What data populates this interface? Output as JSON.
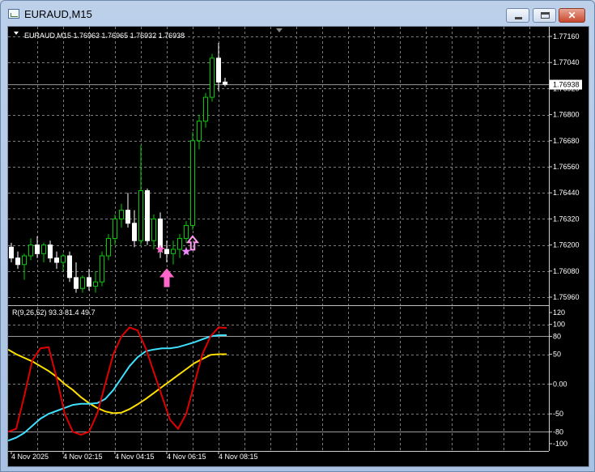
{
  "window": {
    "title": "EURAUD,M15",
    "min_glyph": "",
    "max_glyph": "",
    "close_glyph": "✕"
  },
  "main_chart": {
    "info_text": "EURAUD,M15  1.76963 1.76965 1.76932 1.76938",
    "price_labels": [
      "1.77160",
      "1.77040",
      "1.76920",
      "1.76800",
      "1.76680",
      "1.76560",
      "1.76440",
      "1.76320",
      "1.76200",
      "1.76080",
      "1.75960"
    ],
    "current_price_label": "1.76938"
  },
  "indicator": {
    "info_text": "R(9,26,52) 93.3 81.4 49.7",
    "scale_labels": [
      "120",
      "100",
      "80",
      "50",
      "0.00",
      "-50",
      "-80",
      "-100"
    ]
  },
  "time_labels": [
    "4 Nov 2025",
    "4 Nov 02:15",
    "4 Nov 04:15",
    "4 Nov 06:15",
    "4 Nov 08:15"
  ],
  "colors": {
    "bull": "#00cc00",
    "bear": "#ffffff",
    "grid": "#7a7a7a",
    "red_line": "#e00000",
    "cyan_line": "#40e0ff",
    "yellow_line": "#ffe000",
    "arrow": "#ff66cc",
    "arrow_light": "#ff99ee",
    "star": "#ff66cc",
    "star_light": "#ee88ff"
  },
  "chart_data": {
    "type": "candlestick",
    "price_axis": {
      "min": 1.7596,
      "max": 1.7716
    },
    "current_price": 1.76938,
    "candles": [
      {
        "o": 1.7619,
        "h": 1.7621,
        "l": 1.7612,
        "c": 1.7614
      },
      {
        "o": 1.7614,
        "h": 1.7617,
        "l": 1.7609,
        "c": 1.7611
      },
      {
        "o": 1.7611,
        "h": 1.7616,
        "l": 1.7604,
        "c": 1.7615
      },
      {
        "o": 1.7615,
        "h": 1.7623,
        "l": 1.7613,
        "c": 1.762
      },
      {
        "o": 1.762,
        "h": 1.7624,
        "l": 1.7614,
        "c": 1.7616
      },
      {
        "o": 1.7616,
        "h": 1.7621,
        "l": 1.7612,
        "c": 1.762
      },
      {
        "o": 1.762,
        "h": 1.7622,
        "l": 1.7612,
        "c": 1.7614
      },
      {
        "o": 1.7614,
        "h": 1.7617,
        "l": 1.7609,
        "c": 1.7612
      },
      {
        "o": 1.7612,
        "h": 1.7616,
        "l": 1.7608,
        "c": 1.7615
      },
      {
        "o": 1.7615,
        "h": 1.7617,
        "l": 1.7603,
        "c": 1.7605
      },
      {
        "o": 1.7605,
        "h": 1.7612,
        "l": 1.7598,
        "c": 1.76
      },
      {
        "o": 1.76,
        "h": 1.7606,
        "l": 1.7598,
        "c": 1.7605
      },
      {
        "o": 1.7605,
        "h": 1.7609,
        "l": 1.7599,
        "c": 1.7601
      },
      {
        "o": 1.7601,
        "h": 1.7608,
        "l": 1.7598,
        "c": 1.7603
      },
      {
        "o": 1.7603,
        "h": 1.7617,
        "l": 1.7601,
        "c": 1.7615
      },
      {
        "o": 1.7615,
        "h": 1.7625,
        "l": 1.7613,
        "c": 1.7623
      },
      {
        "o": 1.7623,
        "h": 1.7634,
        "l": 1.762,
        "c": 1.7632
      },
      {
        "o": 1.7632,
        "h": 1.7639,
        "l": 1.7628,
        "c": 1.7636
      },
      {
        "o": 1.7636,
        "h": 1.7644,
        "l": 1.7628,
        "c": 1.763
      },
      {
        "o": 1.763,
        "h": 1.7636,
        "l": 1.7619,
        "c": 1.7622
      },
      {
        "o": 1.7622,
        "h": 1.7666,
        "l": 1.762,
        "c": 1.7645
      },
      {
        "o": 1.7645,
        "h": 1.7646,
        "l": 1.762,
        "c": 1.7622
      },
      {
        "o": 1.7622,
        "h": 1.7634,
        "l": 1.7618,
        "c": 1.7632
      },
      {
        "o": 1.7632,
        "h": 1.7635,
        "l": 1.7614,
        "c": 1.7618
      },
      {
        "o": 1.7618,
        "h": 1.7622,
        "l": 1.7612,
        "c": 1.7616
      },
      {
        "o": 1.7616,
        "h": 1.7622,
        "l": 1.7611,
        "c": 1.7618
      },
      {
        "o": 1.7618,
        "h": 1.7625,
        "l": 1.7614,
        "c": 1.7623
      },
      {
        "o": 1.7623,
        "h": 1.7631,
        "l": 1.7621,
        "c": 1.7629
      },
      {
        "o": 1.7629,
        "h": 1.7672,
        "l": 1.7627,
        "c": 1.7668
      },
      {
        "o": 1.7668,
        "h": 1.768,
        "l": 1.7664,
        "c": 1.7677
      },
      {
        "o": 1.7677,
        "h": 1.769,
        "l": 1.7674,
        "c": 1.7688
      },
      {
        "o": 1.7688,
        "h": 1.7708,
        "l": 1.7686,
        "c": 1.7706
      },
      {
        "o": 1.7706,
        "h": 1.7713,
        "l": 1.7691,
        "c": 1.7695
      },
      {
        "o": 1.7695,
        "h": 1.7697,
        "l": 1.7693,
        "c": 1.7694
      }
    ],
    "signals": [
      {
        "type": "arrow",
        "index": 24,
        "price": 1.7609,
        "size": "large",
        "color": "arrow"
      },
      {
        "type": "arrow",
        "index": 28,
        "price": 1.7624,
        "size": "small",
        "color": "arrow_light"
      },
      {
        "type": "star",
        "index": 23,
        "price": 1.7618,
        "color": "star"
      },
      {
        "type": "star",
        "index": 27,
        "price": 1.7617,
        "color": "star_light"
      }
    ],
    "indicator": {
      "name": "R(9,26,52)",
      "axis": {
        "min": -100,
        "max": 120
      },
      "red": [
        -80,
        -75,
        -20,
        40,
        60,
        62,
        10,
        -50,
        -80,
        -85,
        -80,
        -50,
        0,
        50,
        80,
        95,
        90,
        60,
        20,
        -20,
        -60,
        -75,
        -50,
        0,
        50,
        80,
        95,
        94
      ],
      "cyan": [
        -95,
        -90,
        -82,
        -70,
        -58,
        -50,
        -45,
        -40,
        -35,
        -33,
        -33,
        -32,
        -25,
        -10,
        10,
        30,
        45,
        55,
        58,
        60,
        60,
        62,
        66,
        70,
        75,
        80,
        82,
        82
      ],
      "yellow": [
        58,
        50,
        44,
        38,
        30,
        22,
        12,
        0,
        -10,
        -22,
        -32,
        -40,
        -46,
        -49,
        -48,
        -42,
        -34,
        -25,
        -15,
        -5,
        5,
        15,
        25,
        35,
        42,
        49,
        50,
        50
      ]
    },
    "time_axis": {
      "labels_at_index": [
        0,
        8,
        16,
        24,
        32
      ]
    }
  }
}
